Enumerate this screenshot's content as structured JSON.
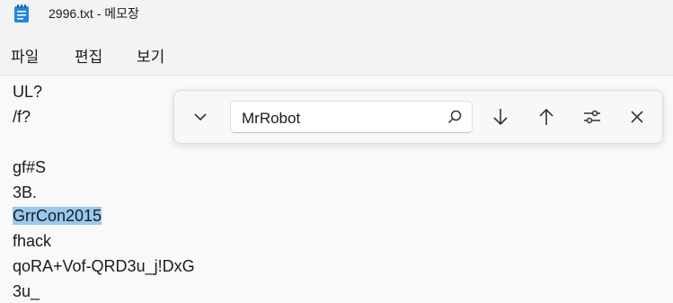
{
  "window": {
    "title": "2996.txt - 메모장",
    "app_icon": "notepad-icon"
  },
  "menu": {
    "items": [
      "파일",
      "편집",
      "보기"
    ]
  },
  "editor": {
    "lines": [
      "UL?",
      "/f?",
      "",
      "gf#S",
      "3B.",
      "GrrCon2015",
      "fhack",
      "qoRA+Vof-QRD3u_j!DxG",
      "3u_"
    ],
    "selected_line": "GrrCon2015"
  },
  "find": {
    "value": "MrRobot",
    "icons": [
      "chevron-down-icon",
      "search-icon",
      "arrow-down-icon",
      "arrow-up-icon",
      "options-icon",
      "close-icon"
    ]
  },
  "colors": {
    "selection": "#99c9ef",
    "app_icon": "#1e88e5"
  }
}
